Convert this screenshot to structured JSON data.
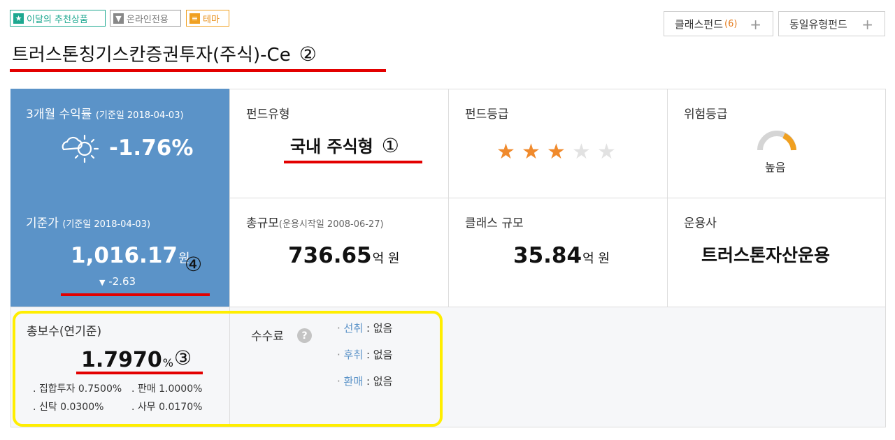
{
  "badges": [
    {
      "icon": "★",
      "label": "이달의 추천상품"
    },
    {
      "icon": "▼",
      "label": "온라인전용"
    },
    {
      "icon": "≡",
      "label": "테마"
    }
  ],
  "top_buttons": {
    "class_fund": {
      "label": "클래스펀드",
      "count": "(6)",
      "plus": "+"
    },
    "same_type": {
      "label": "동일유형펀드",
      "plus": "+"
    }
  },
  "fund": {
    "name": "트러스톤칭기스칸증권투자(주식)-Ce",
    "marker": "②"
  },
  "return_3m": {
    "label": "3개월 수익률",
    "date": "(기준일 2018-04-03)",
    "value": "-1.76%",
    "icon": "partly-cloudy-icon"
  },
  "fund_type": {
    "label": "펀드유형",
    "value": "국내 주식형",
    "marker": "①"
  },
  "fund_grade": {
    "label": "펀드등급",
    "stars": 3,
    "max": 5
  },
  "risk": {
    "label": "위험등급",
    "value": "높음"
  },
  "base_price": {
    "label": "기준가",
    "date": "(기준일 2018-04-03)",
    "value": "1,016.17",
    "unit": "원",
    "change": "-2.63",
    "marker": "④"
  },
  "total_size": {
    "label": "총규모",
    "date": "(운용시작일 2008-06-27)",
    "value": "736.65",
    "unit": "억 원"
  },
  "class_size": {
    "label": "클래스 규모",
    "value": "35.84",
    "unit": "억 원"
  },
  "manager": {
    "label": "운용사",
    "value": "트러스톤자산운용"
  },
  "total_fee": {
    "label": "총보수(연기준)",
    "value": "1.7970",
    "unit": "%",
    "marker": "③",
    "details": [
      {
        "text": "집합투자 0.7500%"
      },
      {
        "text": "판매 1.0000%"
      },
      {
        "text": "신탁 0.0300%"
      },
      {
        "text": "사무 0.0170%"
      }
    ]
  },
  "commission": {
    "label": "수수료",
    "help": "?",
    "rows": [
      {
        "key": "선취",
        "value": "없음"
      },
      {
        "key": "후취",
        "value": "없음"
      },
      {
        "key": "환매",
        "value": "없음"
      }
    ]
  },
  "colors": {
    "accent_blue": "#5b93c8",
    "star_on": "#f08a2c",
    "star_off": "#e2e2e2",
    "red_underline": "#e30000",
    "highlight": "#ffee00"
  }
}
